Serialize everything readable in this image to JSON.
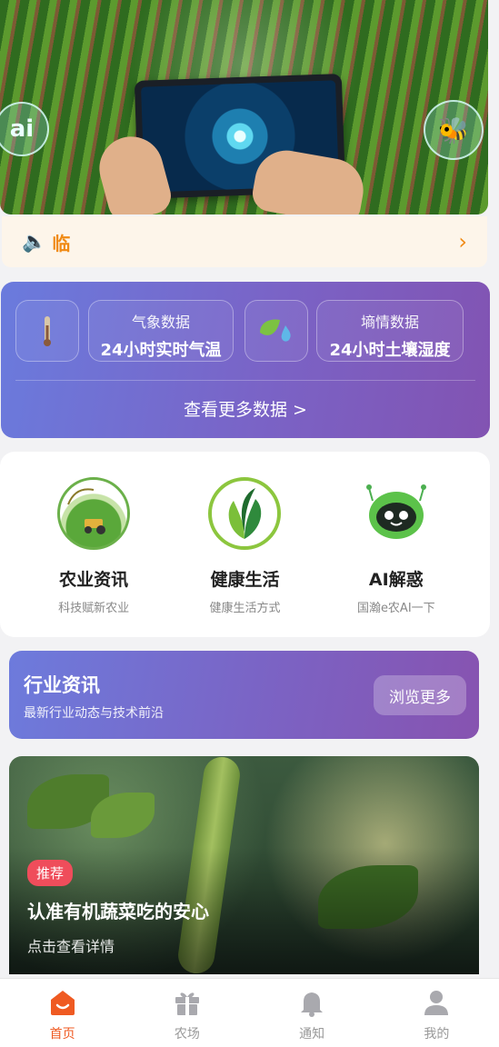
{
  "notice": {
    "text": "临"
  },
  "data_card": {
    "weather": {
      "title": "气象数据",
      "value": "24小时实时气温"
    },
    "soil": {
      "title": "墒情数据",
      "value": "24小时土壤湿度"
    },
    "more_label": "查看更多数据 >"
  },
  "features": [
    {
      "title": "农业资讯",
      "subtitle": "科技赋新农业"
    },
    {
      "title": "健康生活",
      "subtitle": "健康生活方式"
    },
    {
      "title": "AI解惑",
      "subtitle": "国瀚e农AI一下"
    }
  ],
  "hero": {
    "bubble_text": "ai"
  },
  "industry": {
    "title": "行业资讯",
    "subtitle": "最新行业动态与技术前沿",
    "button": "浏览更多"
  },
  "article": {
    "tag": "推荐",
    "headline": "认准有机蔬菜吃的安心",
    "cta": "点击查看详情"
  },
  "nav": {
    "items": [
      {
        "label": "首页"
      },
      {
        "label": "农场"
      },
      {
        "label": "通知"
      },
      {
        "label": "我的"
      }
    ],
    "active_index": 0
  },
  "colors": {
    "accent_orange": "#ef5a22",
    "notice_orange": "#f08a14",
    "purple_gradient_start": "#6a7bdd",
    "purple_gradient_end": "#8253b2",
    "tag_red": "#ef4d5b"
  }
}
